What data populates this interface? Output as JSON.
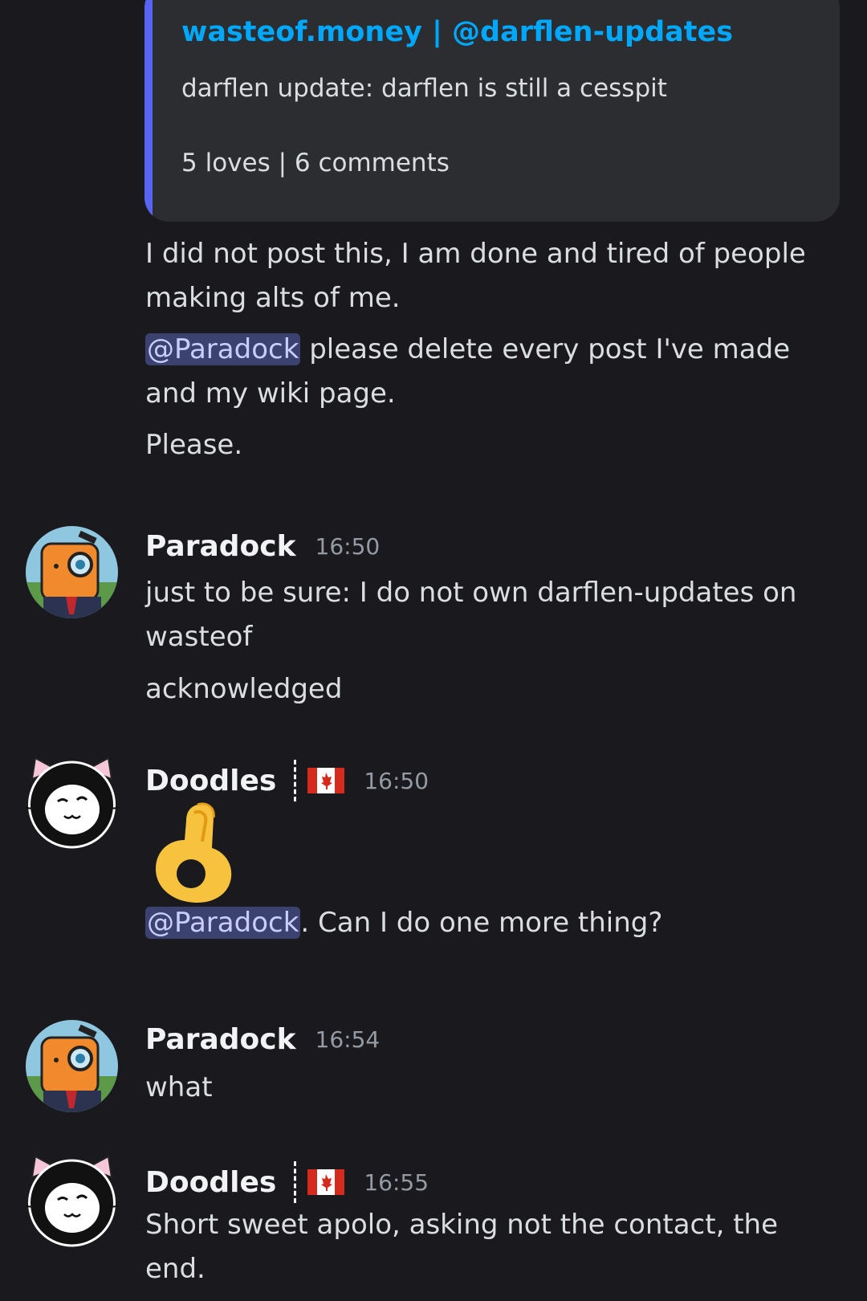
{
  "embed": {
    "title": "wasteof.money | @darflen-updates",
    "description": "darflen update: darflen is still a cesspit",
    "stats": "5 loves | 6 comments",
    "accent_color": "#5865f2"
  },
  "messages": {
    "m0": {
      "line1": "I did not post this, I am done and tired of people",
      "line2": "making alts of me.",
      "mention": "@Paradock",
      "line3_rest": " please delete every post I've made",
      "line4": "and my wiki page.",
      "line5": "Please."
    },
    "m1": {
      "author": "Paradock",
      "time": "16:50",
      "line1": "just to be sure: I do not own darflen-updates on",
      "line2": "wasteof",
      "line3": "acknowledged"
    },
    "m2": {
      "author": "Doodles",
      "time": "16:50",
      "flag_icon": "canada-flag-icon",
      "emoji": "ok-hand-emoji",
      "mention": "@Paradock",
      "rest": ". Can I do one more thing?"
    },
    "m3": {
      "author": "Paradock",
      "time": "16:54",
      "line1": "what"
    },
    "m4": {
      "author": "Doodles",
      "time": "16:55",
      "flag_icon": "canada-flag-icon",
      "line1": "Short sweet apolo, asking not the contact, the",
      "line2": "end."
    }
  },
  "colors": {
    "background": "#1a1a1e",
    "link": "#00a8fc",
    "mention_bg": "#3c4270"
  }
}
